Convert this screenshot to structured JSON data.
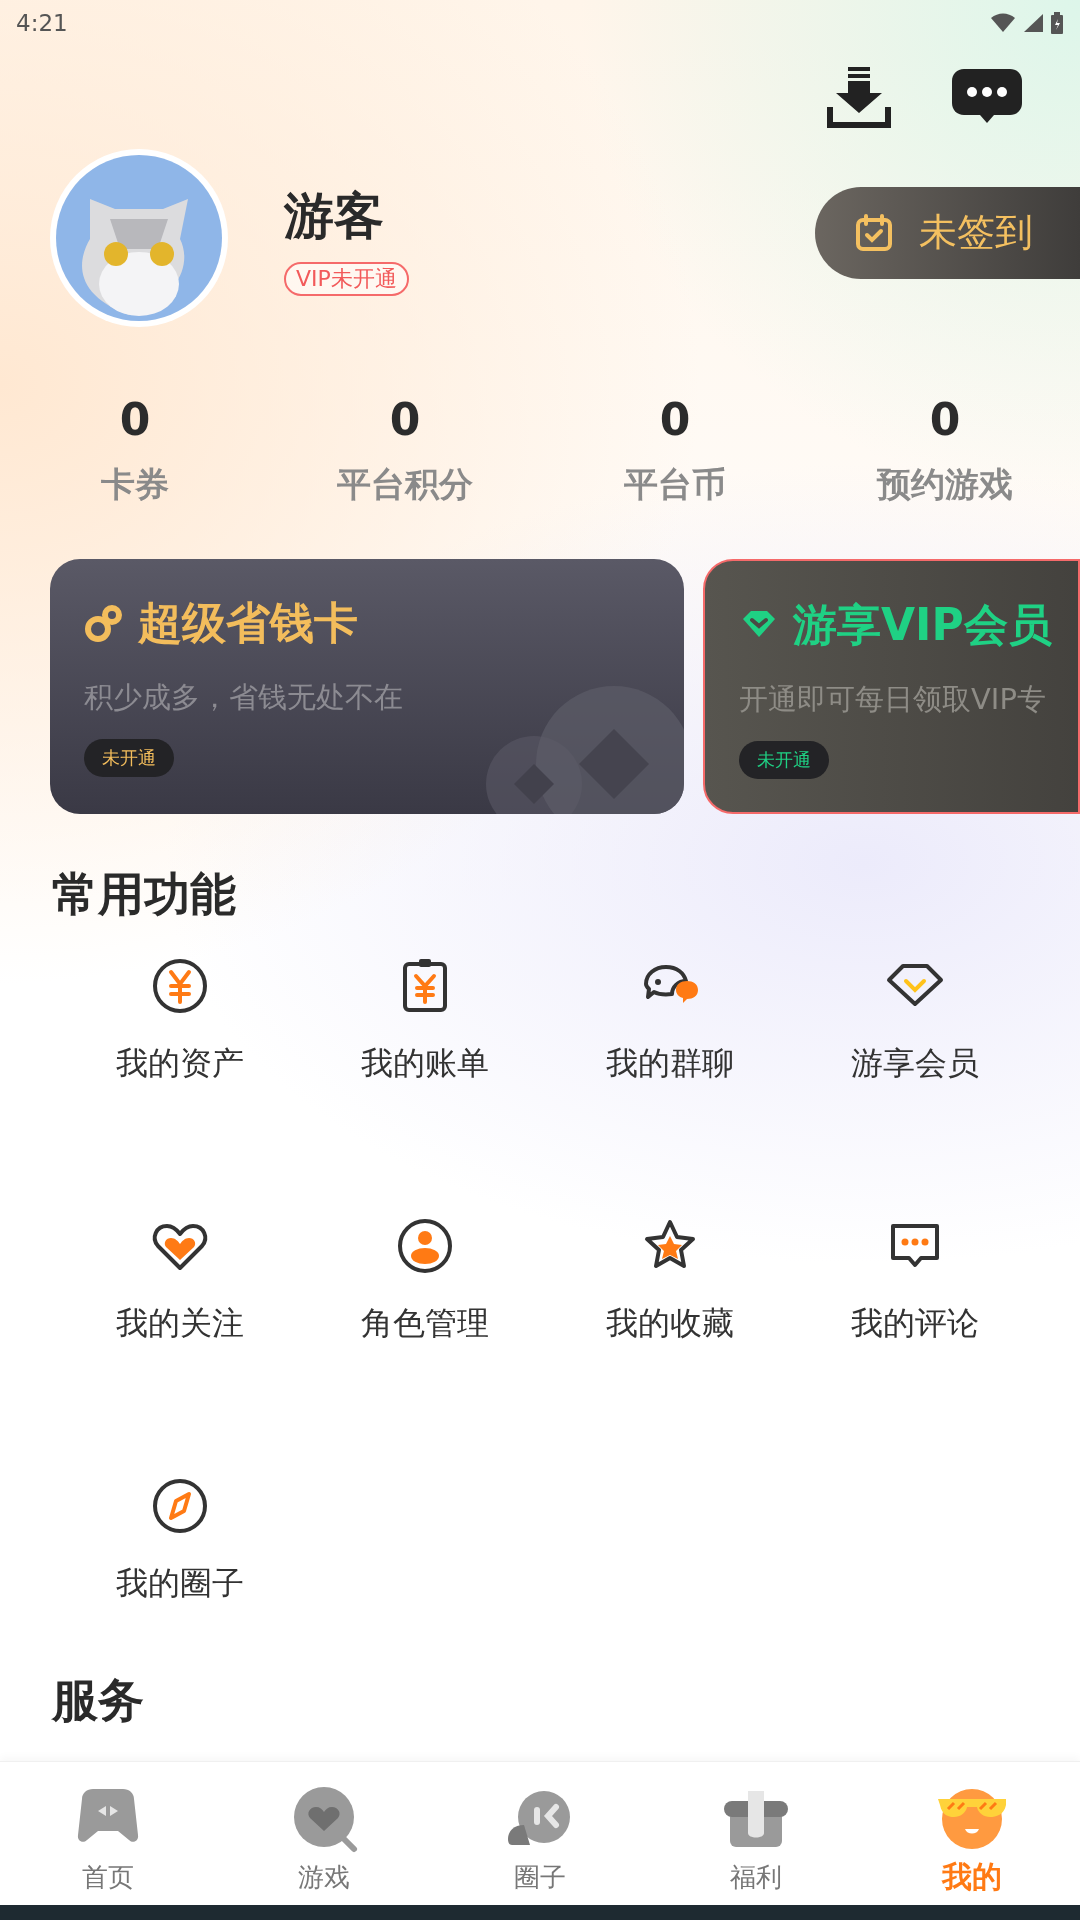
{
  "status_bar": {
    "time": "4:21"
  },
  "profile": {
    "name": "游客",
    "vip_badge": "VIP未开通",
    "sign_in": "未签到"
  },
  "stats": [
    {
      "value": "0",
      "label": "卡券"
    },
    {
      "value": "0",
      "label": "平台积分"
    },
    {
      "value": "0",
      "label": "平台币"
    },
    {
      "value": "0",
      "label": "预约游戏"
    }
  ],
  "cards": [
    {
      "kind": "saver",
      "title": "超级省钱卡",
      "subtitle": "积少成多，省钱无处不在",
      "status": "未开通"
    },
    {
      "kind": "vip",
      "title": "游享VIP会员",
      "subtitle": "开通即可每日领取VIP专",
      "status": "未开通"
    }
  ],
  "common_functions": {
    "title": "常用功能",
    "items": [
      {
        "label": "我的资产"
      },
      {
        "label": "我的账单"
      },
      {
        "label": "我的群聊"
      },
      {
        "label": "游享会员"
      },
      {
        "label": "我的关注"
      },
      {
        "label": "角色管理"
      },
      {
        "label": "我的收藏"
      },
      {
        "label": "我的评论"
      },
      {
        "label": "我的圈子"
      }
    ]
  },
  "services": {
    "title": "服务"
  },
  "bottom_nav": [
    {
      "label": "首页",
      "selected": false
    },
    {
      "label": "游戏",
      "selected": false
    },
    {
      "label": "圈子",
      "selected": false
    },
    {
      "label": "福利",
      "selected": false
    },
    {
      "label": "我的",
      "selected": true
    }
  ]
}
